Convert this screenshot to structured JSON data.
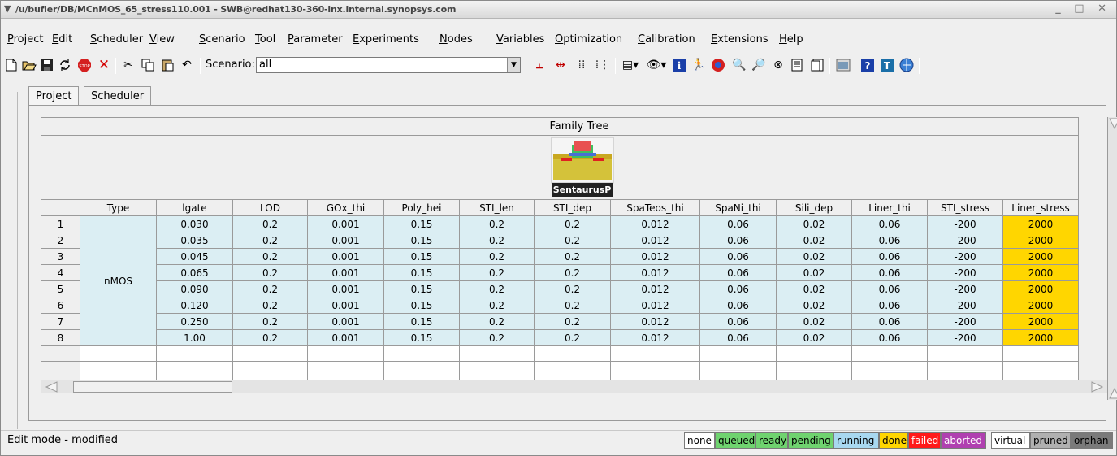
{
  "window": {
    "title": "/u/bufler/DB/MCnMOS_65_stress110.001 - SWB@redhat130-360-lnx.internal.synopsys.com",
    "controls": "_ □ ✕"
  },
  "menu": [
    "Project",
    "Edit",
    "Scheduler",
    "View",
    "Scenario",
    "Tool",
    "Parameter",
    "Experiments",
    "Nodes",
    "Variables",
    "Optimization",
    "Calibration",
    "Extensions",
    "Help"
  ],
  "toolbar": {
    "scenario_label": "Scenario:",
    "scenario_value": "all"
  },
  "tabs": [
    "Project",
    "Scheduler"
  ],
  "grid": {
    "family_tree_label": "Family Tree",
    "tool_name": "SentaurusP",
    "type_header": "Type",
    "type_value": "nMOS",
    "columns": [
      "lgate",
      "LOD",
      "GOx_thi",
      "Poly_hei",
      "STI_len",
      "STI_dep",
      "SpaTeos_thi",
      "SpaNi_thi",
      "Sili_dep",
      "Liner_thi",
      "STI_stress",
      "Liner_stress"
    ],
    "rows": [
      {
        "num": "1",
        "values": [
          "0.030",
          "0.2",
          "0.001",
          "0.15",
          "0.2",
          "0.2",
          "0.012",
          "0.06",
          "0.02",
          "0.06",
          "-200",
          "2000"
        ]
      },
      {
        "num": "2",
        "values": [
          "0.035",
          "0.2",
          "0.001",
          "0.15",
          "0.2",
          "0.2",
          "0.012",
          "0.06",
          "0.02",
          "0.06",
          "-200",
          "2000"
        ]
      },
      {
        "num": "3",
        "values": [
          "0.045",
          "0.2",
          "0.001",
          "0.15",
          "0.2",
          "0.2",
          "0.012",
          "0.06",
          "0.02",
          "0.06",
          "-200",
          "2000"
        ]
      },
      {
        "num": "4",
        "values": [
          "0.065",
          "0.2",
          "0.001",
          "0.15",
          "0.2",
          "0.2",
          "0.012",
          "0.06",
          "0.02",
          "0.06",
          "-200",
          "2000"
        ]
      },
      {
        "num": "5",
        "values": [
          "0.090",
          "0.2",
          "0.001",
          "0.15",
          "0.2",
          "0.2",
          "0.012",
          "0.06",
          "0.02",
          "0.06",
          "-200",
          "2000"
        ]
      },
      {
        "num": "6",
        "values": [
          "0.120",
          "0.2",
          "0.001",
          "0.15",
          "0.2",
          "0.2",
          "0.012",
          "0.06",
          "0.02",
          "0.06",
          "-200",
          "2000"
        ]
      },
      {
        "num": "7",
        "values": [
          "0.250",
          "0.2",
          "0.001",
          "0.15",
          "0.2",
          "0.2",
          "0.012",
          "0.06",
          "0.02",
          "0.06",
          "-200",
          "2000"
        ]
      },
      {
        "num": "8",
        "values": [
          "1.00",
          "0.2",
          "0.001",
          "0.15",
          "0.2",
          "0.2",
          "0.012",
          "0.06",
          "0.02",
          "0.06",
          "-200",
          "2000"
        ]
      }
    ]
  },
  "status": {
    "text": "Edit mode - modified",
    "legend": [
      {
        "label": "none",
        "bg": "#ffffff",
        "fg": "#000000"
      },
      {
        "label": "queued",
        "bg": "#6fd36f",
        "fg": "#000000"
      },
      {
        "label": "ready",
        "bg": "#6fd36f",
        "fg": "#000000"
      },
      {
        "label": "pending",
        "bg": "#6fd36f",
        "fg": "#000000"
      },
      {
        "label": "running",
        "bg": "#a8d8f0",
        "fg": "#000000"
      },
      {
        "label": "done",
        "bg": "#ffd600",
        "fg": "#000000"
      },
      {
        "label": "failed",
        "bg": "#ff1a1a",
        "fg": "#ffffff"
      },
      {
        "label": "aborted",
        "bg": "#b040b0",
        "fg": "#ffffff"
      },
      {
        "label": "virtual",
        "bg": "#ffffff",
        "fg": "#000000"
      },
      {
        "label": "pruned",
        "bg": "#b0b0b0",
        "fg": "#000000"
      },
      {
        "label": "orphan",
        "bg": "#7a7a7a",
        "fg": "#000000"
      }
    ]
  },
  "colors": {
    "data_cell": "#dbeef3",
    "done_cell": "#ffd600"
  }
}
